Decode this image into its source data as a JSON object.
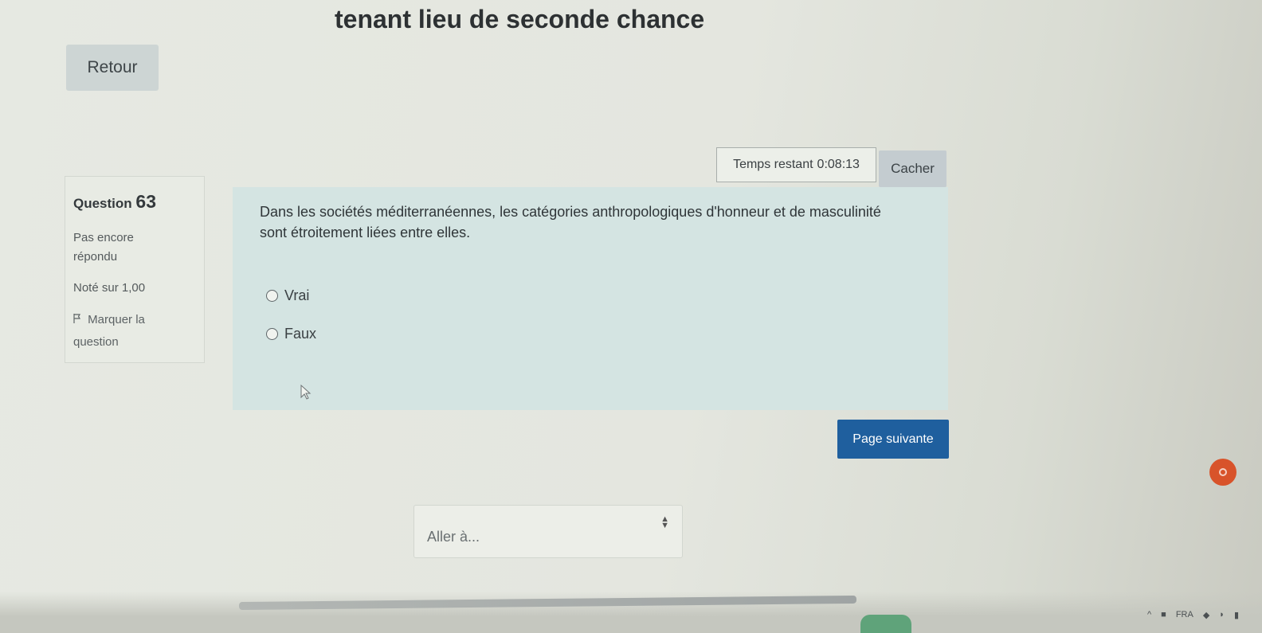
{
  "header": {
    "title": "tenant lieu de seconde chance"
  },
  "nav": {
    "back_label": "Retour"
  },
  "timer": {
    "label": "Temps restant",
    "value": "0:08:13",
    "hide_label": "Cacher"
  },
  "question": {
    "label": "Question",
    "number": "63",
    "state": "Pas encore répondu",
    "grade": "Noté sur 1,00",
    "flag_label": "Marquer la question",
    "text": "Dans les sociétés méditerranéennes, les catégories anthropologiques d'honneur et de masculinité sont étroitement liées entre elles.",
    "options": [
      {
        "label": "Vrai",
        "selected": false
      },
      {
        "label": "Faux",
        "selected": false
      }
    ]
  },
  "actions": {
    "next_label": "Page suivante"
  },
  "jump": {
    "placeholder": "Aller à..."
  },
  "taskbar": {
    "language": "FRA"
  },
  "colors": {
    "primary_button": "#1f5f9e",
    "question_bg": "#d4e4e2",
    "notification": "#d8532a"
  }
}
